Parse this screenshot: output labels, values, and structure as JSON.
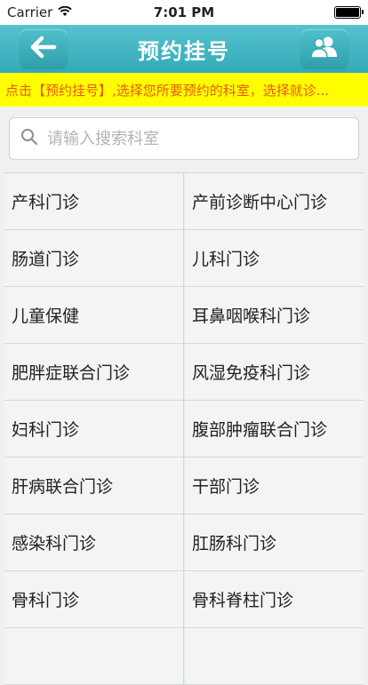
{
  "status_bar": {
    "carrier": "Carrier",
    "time": "7:01 PM"
  },
  "nav": {
    "title": "预约挂号",
    "back_icon": "arrow-left-icon",
    "users_icon": "users-icon"
  },
  "notice": {
    "text": "点击【预约挂号】,选择您所要预约的科室，选择就诊..."
  },
  "search": {
    "placeholder": "请输入搜索科室",
    "value": ""
  },
  "departments": [
    [
      "产科门诊",
      "产前诊断中心门诊"
    ],
    [
      "肠道门诊",
      "儿科门诊"
    ],
    [
      "儿童保健",
      "耳鼻咽喉科门诊"
    ],
    [
      "肥胖症联合门诊",
      "风湿免疫科门诊"
    ],
    [
      "妇科门诊",
      "腹部肿瘤联合门诊"
    ],
    [
      "肝病联合门诊",
      "干部门诊"
    ],
    [
      "感染科门诊",
      "肛肠科门诊"
    ],
    [
      "骨科门诊",
      "骨科脊柱门诊"
    ],
    [
      "",
      ""
    ]
  ],
  "colors": {
    "nav": "#3fb4c1",
    "notice_bg": "#ffff00",
    "notice_text": "#e65c00"
  }
}
